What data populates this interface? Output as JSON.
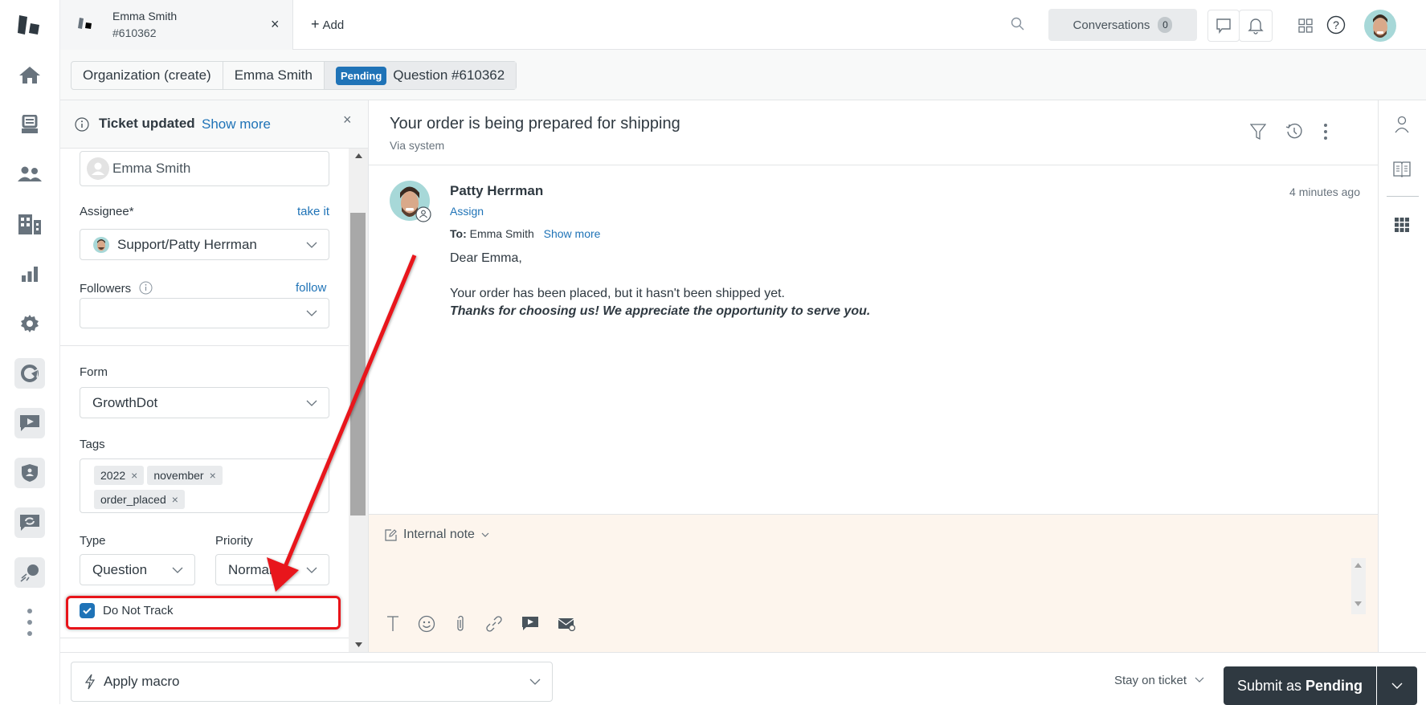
{
  "nav": {
    "items": [
      {
        "name": "home",
        "icon": "home-icon"
      },
      {
        "name": "views",
        "icon": "inbox-icon"
      },
      {
        "name": "customers",
        "icon": "users-icon"
      },
      {
        "name": "organizations",
        "icon": "building-icon"
      },
      {
        "name": "reporting",
        "icon": "bar-chart-icon"
      },
      {
        "name": "admin",
        "icon": "gear-icon"
      },
      {
        "name": "app-1",
        "icon": "app-pie-icon"
      },
      {
        "name": "app-2",
        "icon": "video-chat-icon"
      },
      {
        "name": "app-3",
        "icon": "shield-user-icon"
      },
      {
        "name": "app-4",
        "icon": "chat-refresh-icon"
      },
      {
        "name": "app-5",
        "icon": "comet-icon"
      },
      {
        "name": "more",
        "icon": "more-vertical-icon"
      }
    ]
  },
  "topbar": {
    "tab": {
      "title": "Emma Smith",
      "subtitle": "#610362",
      "close": "×"
    },
    "add_label": "Add",
    "conversations_label": "Conversations",
    "conversations_count": "0"
  },
  "breadcrumb": {
    "organization": "Organization (create)",
    "requester": "Emma Smith",
    "status_badge": "Pending",
    "ticket": "Question #610362"
  },
  "notification": {
    "text": "Ticket updated",
    "link": "Show more",
    "close": "×"
  },
  "fields": {
    "requester_value": "Emma Smith",
    "assignee_label": "Assignee*",
    "assignee_link": "take it",
    "assignee_value": "Support/Patty Herrman",
    "followers_label": "Followers",
    "followers_link": "follow",
    "followers_value": "",
    "form_label": "Form",
    "form_value": "GrowthDot",
    "tags_label": "Tags",
    "tags": [
      "2022",
      "november",
      "order_placed"
    ],
    "type_label": "Type",
    "type_value": "Question",
    "priority_label": "Priority",
    "priority_value": "Normal",
    "do_not_track_label": "Do Not Track",
    "do_not_track_checked": true
  },
  "conversation": {
    "subject": "Your order is being prepared for shipping",
    "via": "Via system",
    "message": {
      "author": "Patty Herrman",
      "assign_link": "Assign",
      "timestamp": "4 minutes ago",
      "to_label": "To:",
      "to_value": "Emma Smith",
      "show_more": "Show more",
      "greeting": "Dear Emma,",
      "body": "Your order has been placed, but it hasn't been shipped yet.",
      "closing": "Thanks for choosing us! We appreciate the opportunity to serve you."
    }
  },
  "composer": {
    "mode": "Internal note",
    "toolbar": [
      "text-format-icon",
      "emoji-icon",
      "attachment-icon",
      "link-icon",
      "video-icon",
      "email-icon"
    ]
  },
  "bottombar": {
    "macro_label": "Apply macro",
    "stay_label": "Stay on ticket",
    "submit_prefix": "Submit as",
    "submit_status": "Pending"
  },
  "colors": {
    "accent": "#1f73b7",
    "submit_bg": "#2f3941",
    "composer_bg": "#fdf5ed",
    "annotation": "#e8141a"
  }
}
